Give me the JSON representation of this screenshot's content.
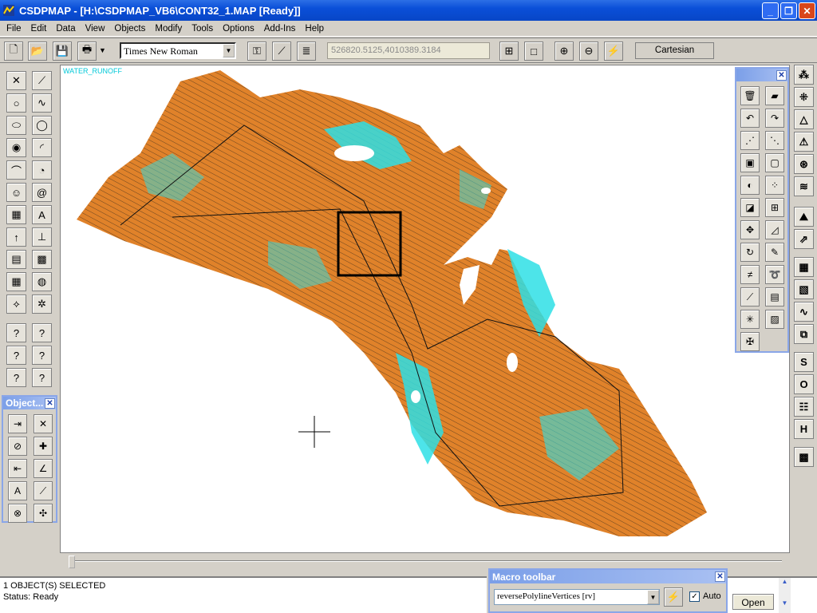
{
  "window": {
    "title": "CSDPMAP - [H:\\CSDPMAP_VB6\\CONT32_1.MAP [Ready]]"
  },
  "menu": [
    "File",
    "Edit",
    "Data",
    "View",
    "Objects",
    "Modify",
    "Tools",
    "Options",
    "Add-Ins",
    "Help"
  ],
  "toolbar": {
    "font": "Times New Roman",
    "coordinates": "526820.5125,4010389.3184",
    "coord_system": "Cartesian"
  },
  "map": {
    "layer_label": "WATER_RUNOFF",
    "colors": {
      "terrain": "#e0822a",
      "water": "#2ee0e6",
      "contour": "#3a2a1a"
    }
  },
  "object_palette": {
    "title": "Object..."
  },
  "macro_toolbar": {
    "title": "Macro toolbar",
    "selected_macro": "reversePolylineVertices [rv]",
    "auto_label": "Auto",
    "auto_checked": true,
    "open_label": "Open"
  },
  "right_toolbar": {
    "letters": [
      "S",
      "O",
      "H"
    ]
  },
  "status": {
    "selection": "1 OBJECT(S) SELECTED",
    "state": "Status: Ready"
  }
}
